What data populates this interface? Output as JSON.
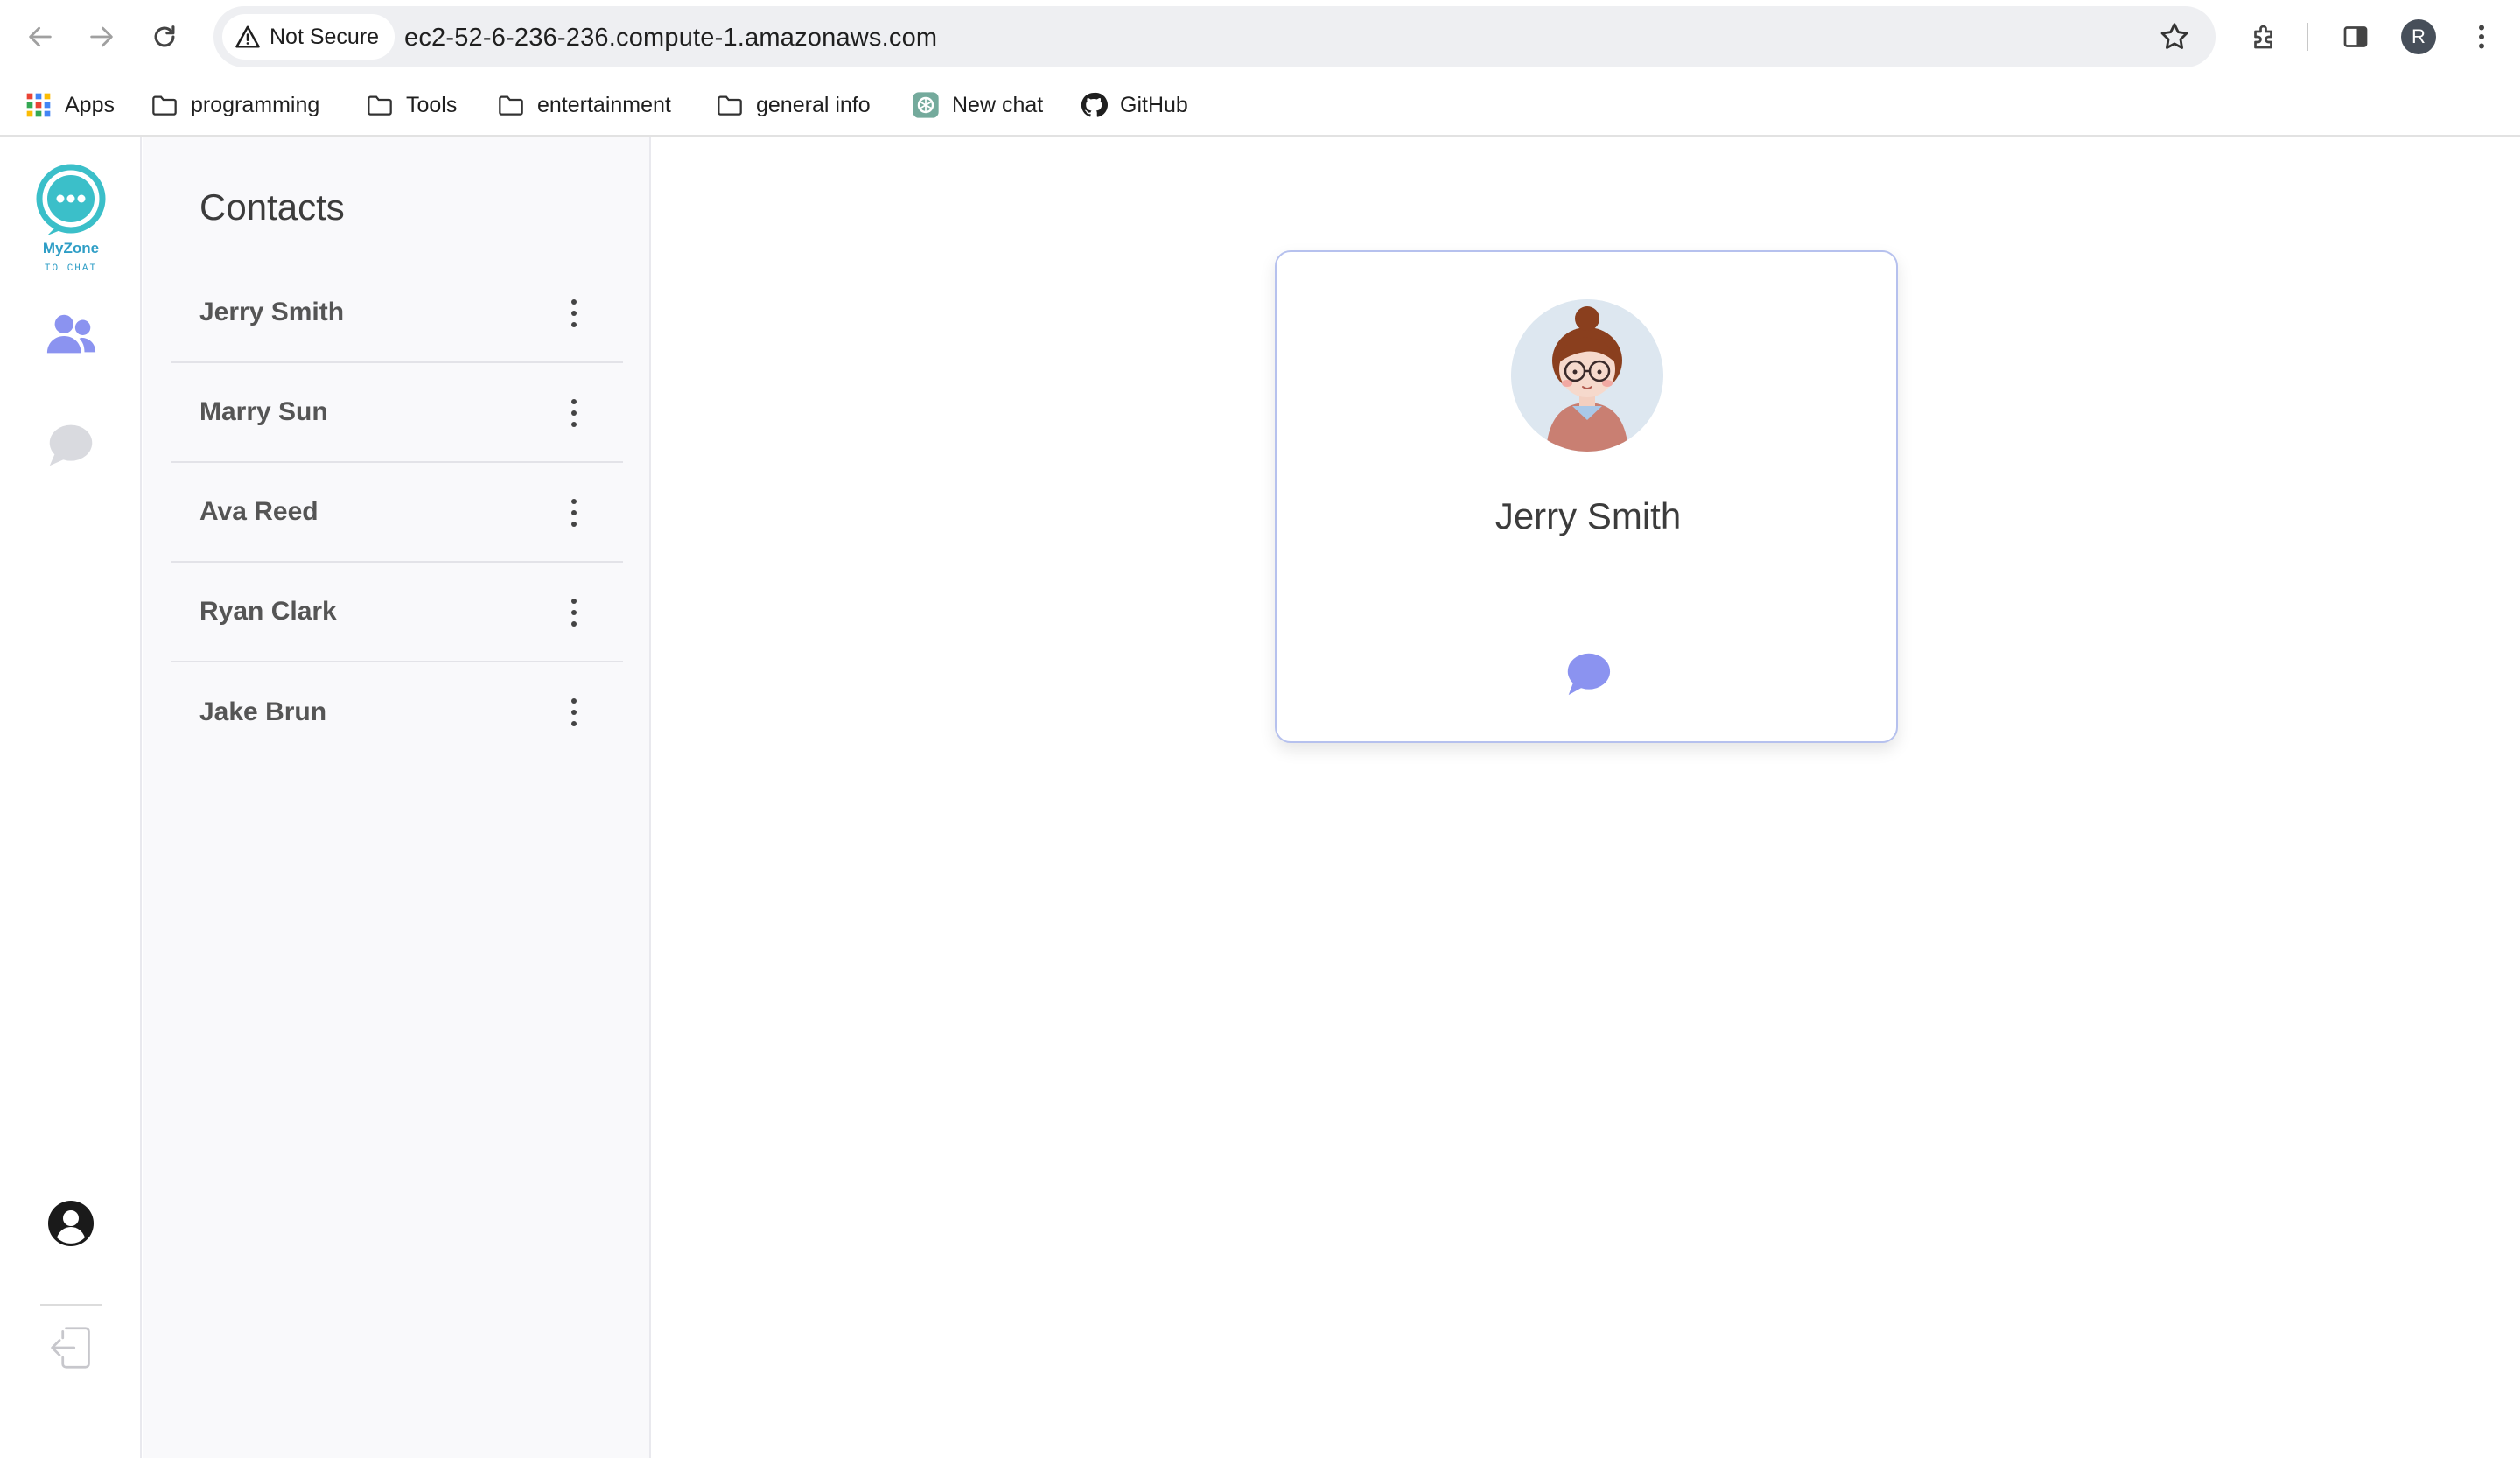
{
  "browser": {
    "security_label": "Not Secure",
    "url": "ec2-52-6-236-236.compute-1.amazonaws.com",
    "profile_initial": "R",
    "bookmarks": [
      {
        "label": "Apps",
        "icon": "apps-grid-icon"
      },
      {
        "label": "programming",
        "icon": "folder-icon"
      },
      {
        "label": "Tools",
        "icon": "folder-icon"
      },
      {
        "label": "entertainment",
        "icon": "folder-icon"
      },
      {
        "label": "general info",
        "icon": "folder-icon"
      },
      {
        "label": "New chat",
        "icon": "openai-icon"
      },
      {
        "label": "GitHub",
        "icon": "github-icon"
      }
    ]
  },
  "app": {
    "logo_text": "MyZone",
    "logo_subtext": "TO CHAT",
    "accent_color": "#8b93f0",
    "logo_color": "#3bbfc9",
    "contacts": {
      "title": "Contacts",
      "items": [
        {
          "name": "Jerry Smith"
        },
        {
          "name": "Marry Sun"
        },
        {
          "name": "Ava Reed"
        },
        {
          "name": "Ryan Clark"
        },
        {
          "name": "Jake Brun"
        }
      ]
    },
    "profile_card": {
      "name": "Jerry Smith"
    }
  }
}
